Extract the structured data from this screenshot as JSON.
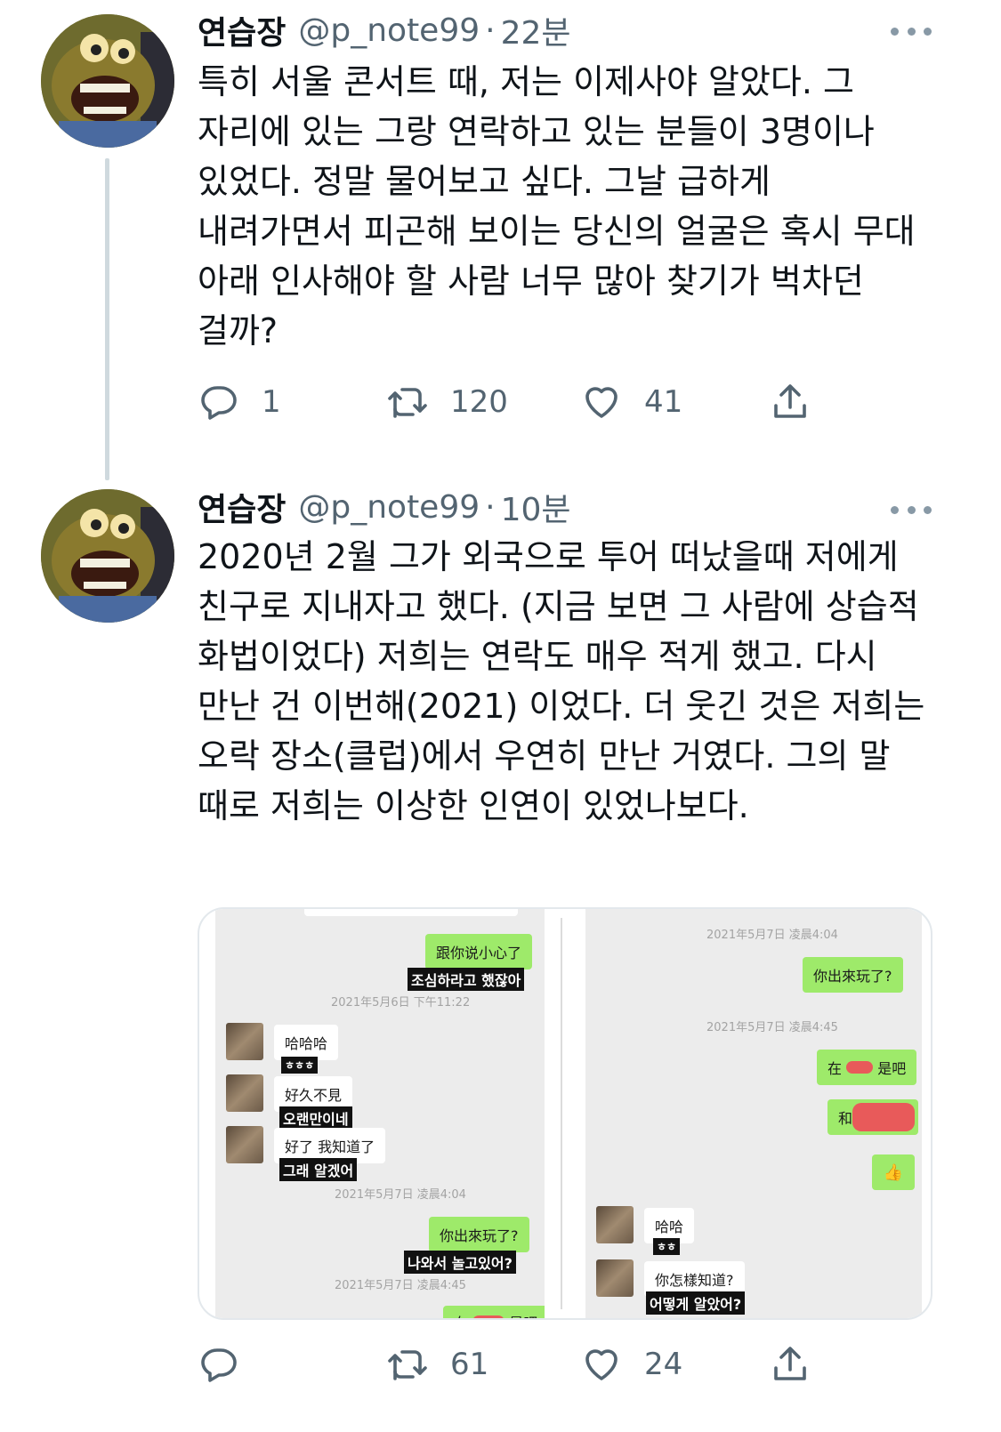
{
  "tweets": [
    {
      "display_name": "연습장",
      "handle": "@p_note99",
      "separator": "·",
      "time": "22분",
      "text": "특히 서울 콘서트 때, 저는 이제사야 알았다. 그 자리에 있는 그랑 연락하고 있는 분들이 3명이나 있었다. 정말 물어보고 싶다. 그날 급하게 내려가면서 피곤해 보이는 당신의 얼굴은 혹시 무대 아래 인사해야 할 사람 너무 많아 찾기가 벅차던 걸까?",
      "replies": "1",
      "retweets": "120",
      "likes": "41"
    },
    {
      "display_name": "연습장",
      "handle": "@p_note99",
      "separator": "·",
      "time": "10분",
      "text": "2020년 2월 그가 외국으로 투어 떠났을때 저에게 친구로 지내자고 했다. (지금 보면 그 사람에 상습적 화법이었다) 저희는 연락도 매우 적게 했고. 다시 만난 건 이번해(2021) 이었다. 더 웃긴 것은 저희는 오락 장소(클럽)에서 우연히 만난 거였다. 그의 말 때로 저희는 이상한 인연이 있었나보다.",
      "replies": "",
      "retweets": "61",
      "likes": "24"
    }
  ],
  "media": {
    "left": {
      "bubble1": "跟你说小心了",
      "bubble1_sub": "조심하라고 했잖아",
      "ts1": "2021年5月6日 下午11:22",
      "msg1": "哈哈哈",
      "msg1_sub": "ㅎㅎㅎ",
      "msg2": "好久不見",
      "msg2_sub": "오랜만이네",
      "msg3": "好了 我知道了",
      "msg3_sub": "그래 알겠어",
      "ts2": "2021年5月7日 凌晨4:04",
      "bubble2": "你出來玩了?",
      "bubble2_sub": "나와서 놀고있어?",
      "ts3": "2021年5月7日 凌晨4:45",
      "bubble3_a": "在",
      "bubble3_b": "是吧"
    },
    "right": {
      "ts1": "2021年5月7日 凌晨4:04",
      "bubble1": "你出來玩了?",
      "ts2": "2021年5月7日 凌晨4:45",
      "bubble2_a": "在",
      "bubble2_b": "是吧",
      "bubble3": "和",
      "thumb": "👍",
      "msg1": "哈哈",
      "msg1_sub": "ㅎㅎ",
      "msg2": "你怎樣知道?",
      "msg2_sub": "어떻게 알았어?"
    }
  },
  "icons": {
    "reply": "reply-icon",
    "retweet": "retweet-icon",
    "like": "heart-icon",
    "share": "share-icon",
    "more": "more-icon"
  },
  "colors": {
    "text": "#0f1419",
    "secondary": "#536471",
    "thread_line": "#cfd9de",
    "chat_green": "#9eea6a"
  }
}
